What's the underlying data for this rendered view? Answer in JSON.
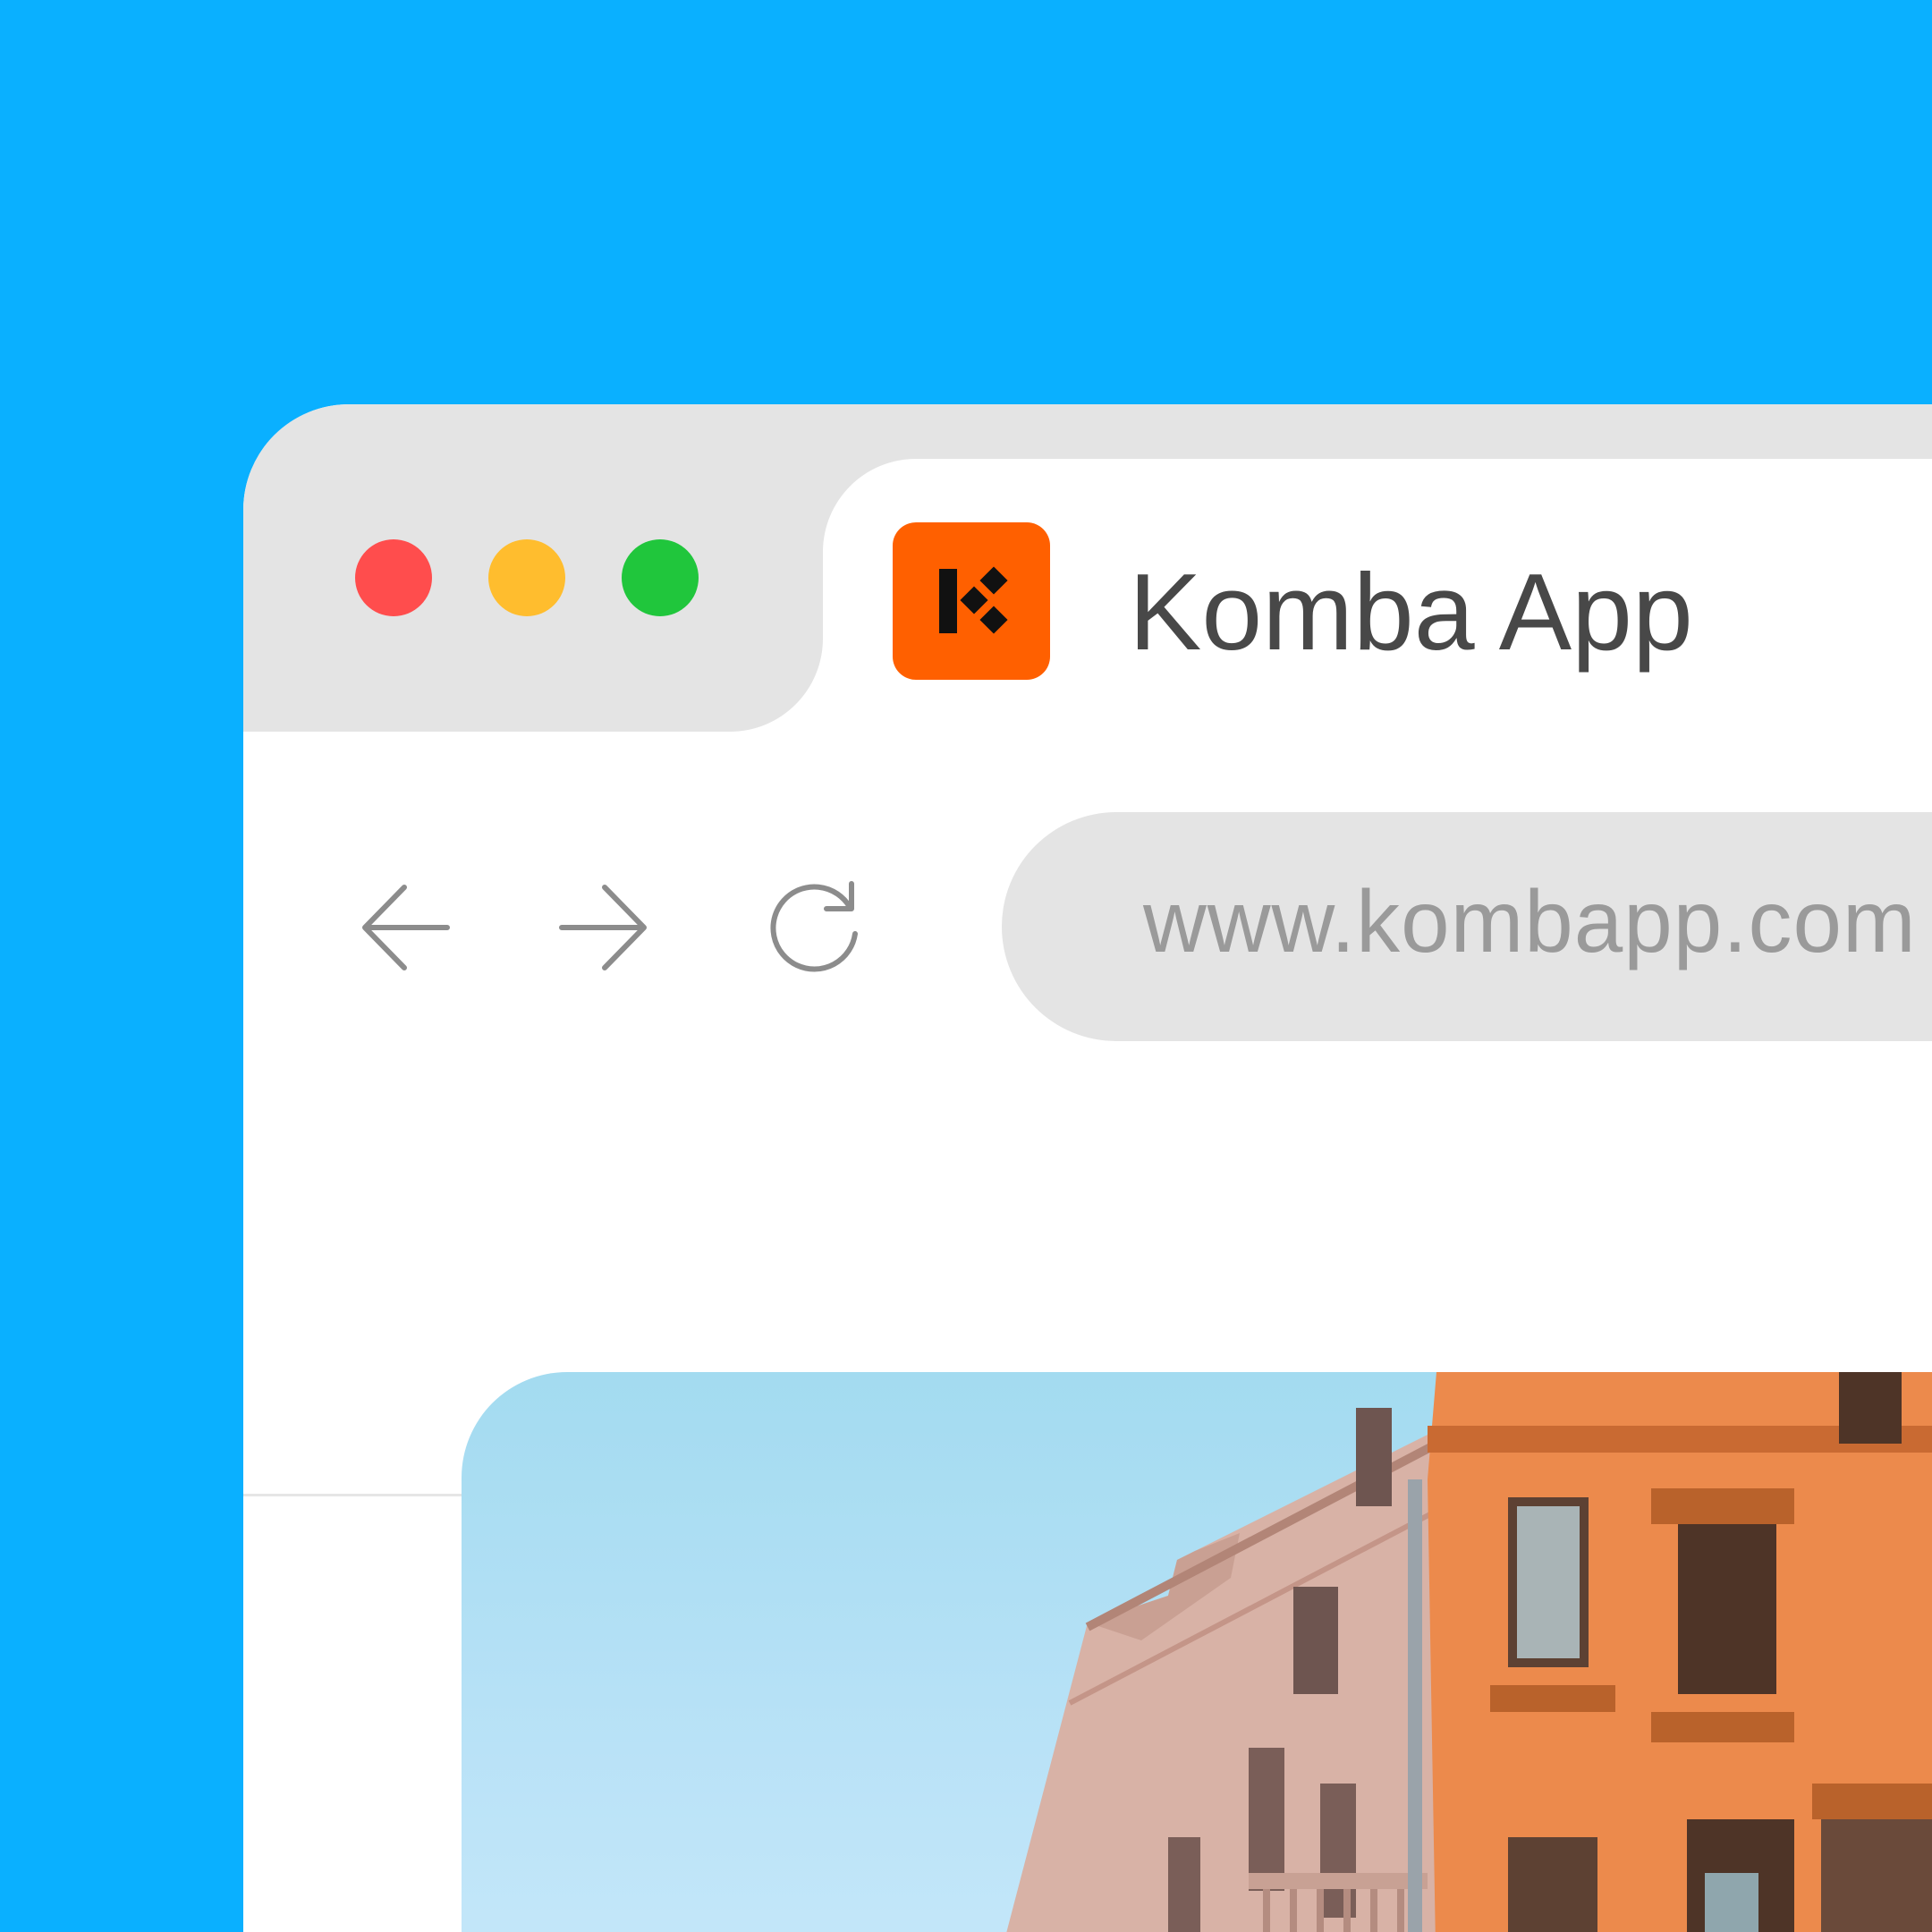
{
  "window_controls": {
    "close_color": "#FF4D4D",
    "minimize_color": "#FFBD2E",
    "maximize_color": "#20C63C"
  },
  "tab": {
    "title": "Komba App",
    "favicon_icon": "komba-logo-icon",
    "favicon_color": "#FF6000"
  },
  "toolbar": {
    "back_icon": "arrow-left-icon",
    "forward_icon": "arrow-right-icon",
    "reload_icon": "reload-icon",
    "address_url": "www.kombapp.com"
  },
  "content": {
    "hero_image": "street-buildings-photo"
  },
  "colors": {
    "background": "#0AB0FF",
    "tab_strip": "#E4E4E4",
    "title_text": "#484848",
    "url_text": "#9A9A9A"
  }
}
